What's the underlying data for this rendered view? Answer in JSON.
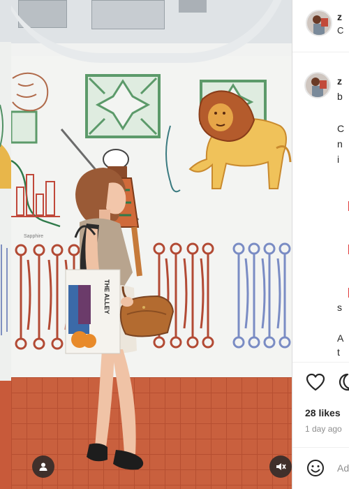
{
  "post": {
    "header_username": "z",
    "header_subtext": "C",
    "caption_username": "z",
    "caption_line1": "b",
    "caption_lines": [
      "C",
      "n",
      "i"
    ],
    "comment_lines": [
      "s",
      "A",
      "t"
    ],
    "likes": "28 likes",
    "time_ago": "1 day ago",
    "add_comment_placeholder": "Ad"
  },
  "media": {
    "tote_text": "THE ALLEY",
    "mural_signature": "Sapphire"
  },
  "icons": {
    "user": "user-tag-icon",
    "mute": "mute-icon",
    "like": "heart-icon",
    "comment": "comment-icon",
    "emoji": "emoji-icon"
  }
}
